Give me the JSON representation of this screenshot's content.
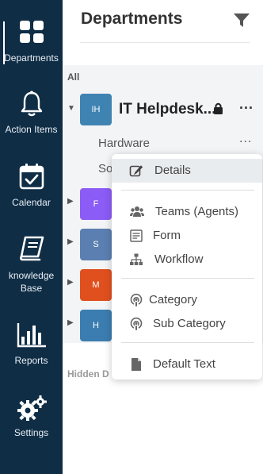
{
  "nav": {
    "items": [
      {
        "label": "Departments",
        "icon": "grid-icon"
      },
      {
        "label": "Action Items",
        "icon": "bell-icon"
      },
      {
        "label": "Calendar",
        "icon": "calendar-check-icon"
      },
      {
        "label": "knowledge Base",
        "label_line1": "knowledge",
        "label_line2": "Base",
        "icon": "book-icon"
      },
      {
        "label": "Reports",
        "icon": "bar-chart-icon"
      },
      {
        "label": "Settings",
        "icon": "gears-icon"
      }
    ],
    "active": "Departments",
    "background": "#0f2d45"
  },
  "header": {
    "title": "Departments",
    "filter_icon": "filter-icon"
  },
  "list": {
    "all_label": "All",
    "departments": [
      {
        "initials": "IH",
        "name": "IT Helpdesk...",
        "color": "#3f83b3",
        "expanded": true,
        "locked": true,
        "more": "..."
      },
      {
        "initials": "F",
        "color": "#8b5cf6"
      },
      {
        "initials": "S",
        "color": "#5b7fb1"
      },
      {
        "initials": "M",
        "color": "#e0501f"
      },
      {
        "initials": "H",
        "color": "#3b7db0"
      }
    ],
    "sub_items": [
      {
        "label": "Hardware",
        "more": "..."
      },
      {
        "label": "So"
      }
    ],
    "hidden_label": "Hidden D"
  },
  "context_menu": {
    "items": [
      {
        "label": "Details",
        "icon": "edit-icon",
        "active": true
      },
      {
        "label": "Teams (Agents)",
        "icon": "users-icon"
      },
      {
        "label": "Form",
        "icon": "form-icon"
      },
      {
        "label": "Workflow",
        "icon": "sitemap-icon"
      },
      {
        "label": "Category",
        "icon": "podcast-icon"
      },
      {
        "label": "Sub Category",
        "icon": "podcast-icon"
      },
      {
        "label": "Default Text",
        "icon": "file-icon"
      }
    ]
  }
}
